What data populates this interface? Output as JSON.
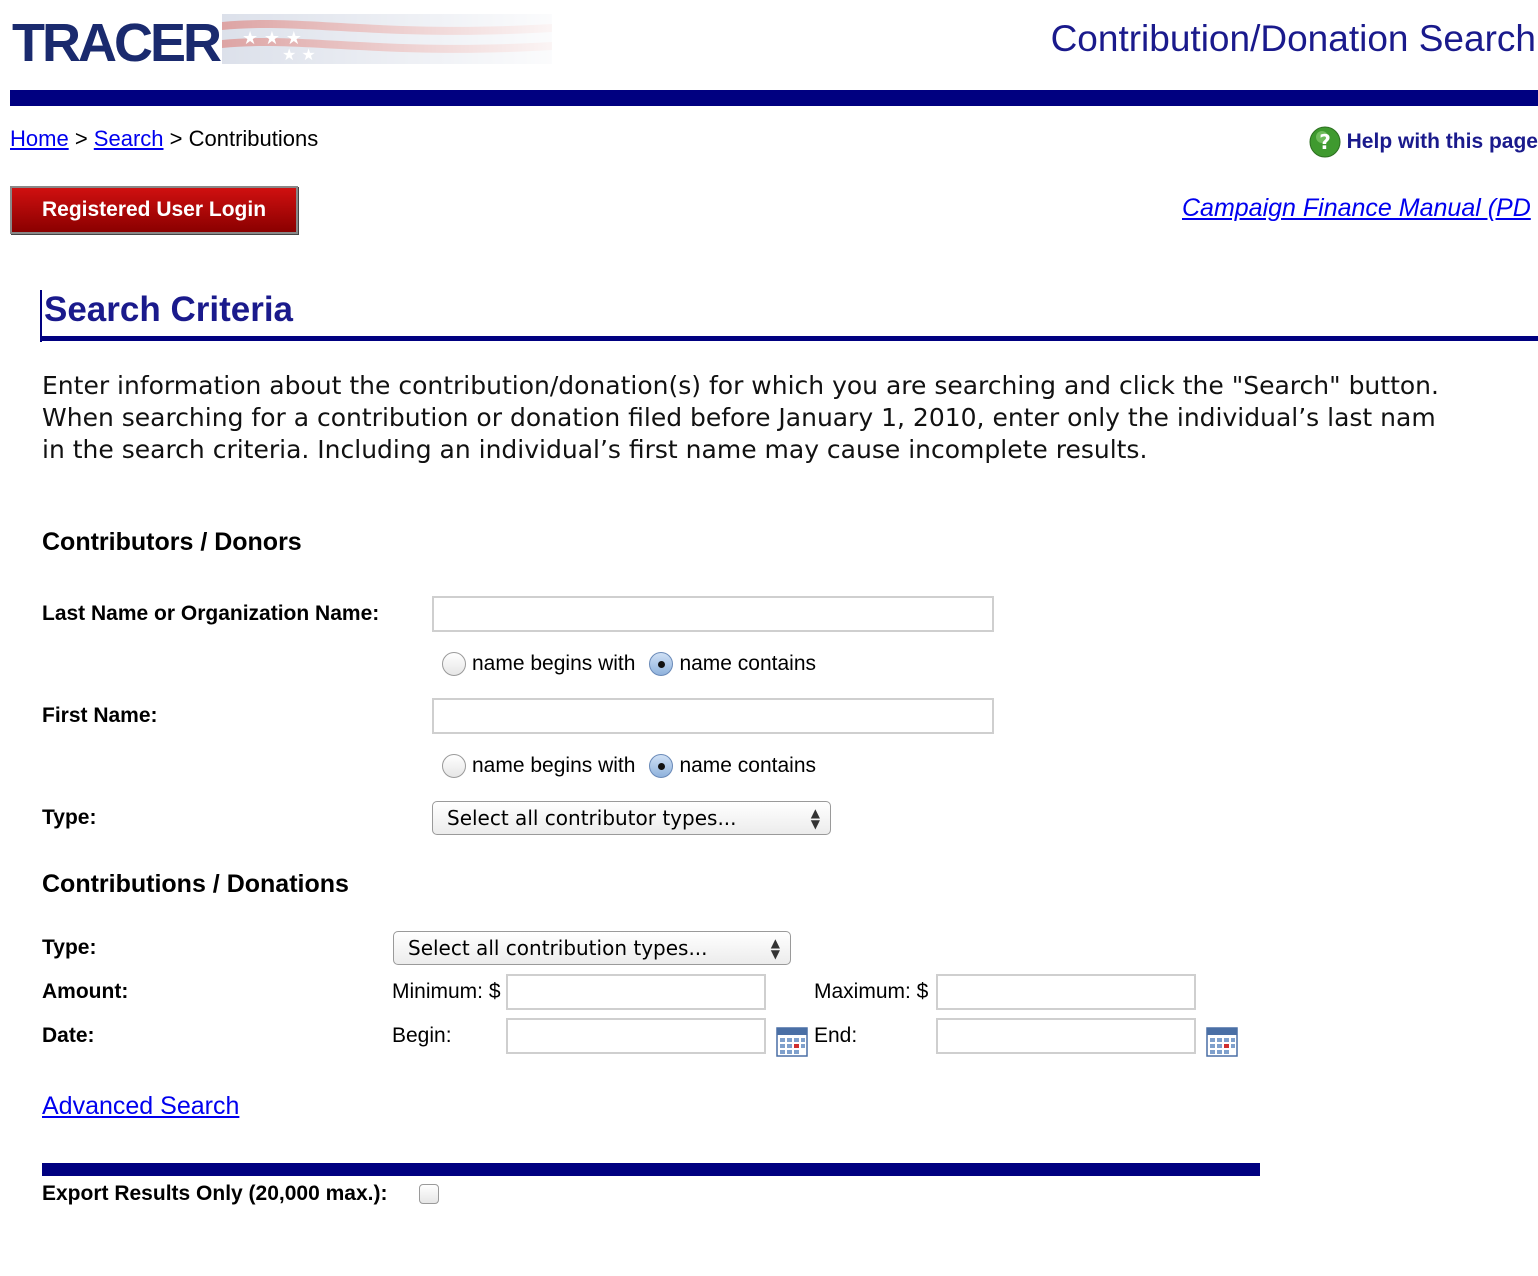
{
  "header": {
    "logo_text": "TRACER",
    "title": "Contribution/Donation Search"
  },
  "breadcrumb": {
    "home": "Home",
    "sep1": ">",
    "search": "Search",
    "sep2": ">",
    "current": "Contributions"
  },
  "help": {
    "label": "Help with this page",
    "icon": "help-question-icon"
  },
  "login_button": "Registered User Login",
  "manual_link": "Campaign Finance Manual (PD",
  "search_criteria": {
    "title": "Search Criteria",
    "intro_lines": [
      "Enter information about the contribution/donation(s) for which you are searching and click the \"Search\" button.",
      "When searching for a contribution or donation filed before January 1, 2010, enter only the individual’s last nam",
      "in the search criteria. Including an individual’s first name may cause incomplete results."
    ]
  },
  "contributors": {
    "heading": "Contributors / Donors",
    "last_name_label": "Last Name or Organization Name:",
    "last_name_value": "",
    "first_name_label": "First Name:",
    "first_name_value": "",
    "radio_begins": "name begins with",
    "radio_contains": "name contains",
    "last_name_match": "contains",
    "first_name_match": "contains",
    "type_label": "Type:",
    "type_selected": "Select all contributor types..."
  },
  "contributions": {
    "heading": "Contributions / Donations",
    "type_label": "Type:",
    "type_selected": "Select all contribution types...",
    "amount_label": "Amount:",
    "minimum_label": "Minimum: $",
    "maximum_label": "Maximum: $",
    "minimum_value": "",
    "maximum_value": "",
    "date_label": "Date:",
    "begin_label": "Begin:",
    "end_label": "End:",
    "begin_value": "",
    "end_value": ""
  },
  "advanced_search": "Advanced Search",
  "export": {
    "label": "Export Results Only (20,000 max.):",
    "checked": false
  },
  "colors": {
    "navy_bar": "#000080",
    "title_blue": "#1a1a8c",
    "login_red": "#b00000",
    "link": "#0000ee"
  }
}
